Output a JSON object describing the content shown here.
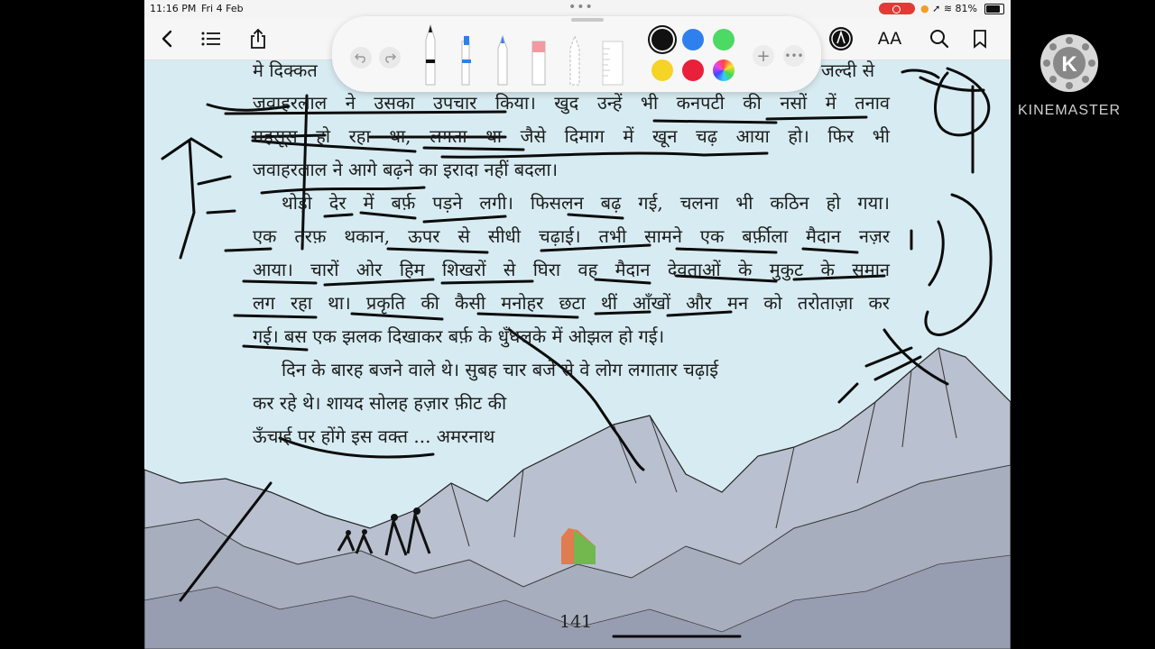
{
  "status_bar": {
    "time": "11:16 PM",
    "date": "Fri 4 Feb",
    "battery": "81%"
  },
  "toolbar": {
    "font_size_label": "AA"
  },
  "colors": {
    "swatches": [
      "#111111",
      "#2f80ed",
      "#4cd964",
      "#f5d327",
      "#e8203a",
      "multicolor"
    ],
    "page_background": "#d7ecf2",
    "recording_indicator": "#e53935"
  },
  "icons": [
    "back-icon",
    "list-icon",
    "share-icon",
    "undo-icon",
    "redo-icon",
    "pen-icon",
    "marker-icon",
    "pencil-icon",
    "eraser-icon",
    "lasso-icon",
    "ruler-icon",
    "plus-icon",
    "more-icon",
    "markup-icon",
    "search-icon",
    "bookmark-icon"
  ],
  "page": {
    "lines": [
      "मे दिक्कत",
      "जल्दी से",
      "जवाहरलाल ने उसका उपचार किया। खुद उन्हें भी कनपटी की नसों में तनाव",
      "महसूस हो रहा था, लगता था जैसे दिमाग में खून चढ़ आया हो। फिर भी",
      "जवाहरलाल ने आगे बढ़ने का इरादा नहीं बदला।",
      "थोड़ी देर में बर्फ़ पड़ने लगी। फिसलन बढ़ गई, चलना भी कठिन हो गया।",
      "एक तरफ़ थकान, ऊपर से सीधी चढ़ाई। तभी सामने एक बर्फ़ीला मैदान नज़र",
      "आया। चारों ओर हिम शिखरों से घिरा वह मैदान देवताओं के मुकुट के समान",
      "लग रहा था। प्रकृति की कैसी मनोहर छटा थीं आँखों और मन को तरोताज़ा कर",
      "गई। बस एक झलक दिखाकर बर्फ़ के धुँधलके में ओझल हो गई।",
      "दिन के बारह बजने वाले थे। सुबह चार बजे से वे लोग लगातार चढ़ाई",
      "कर रहे थे। शायद सोलह हज़ार फ़ीट की",
      "ऊँचाई पर होंगे इस वक्त ... अमरनाथ"
    ],
    "page_number": "141"
  },
  "watermark": {
    "brand": "KINEMASTER"
  }
}
